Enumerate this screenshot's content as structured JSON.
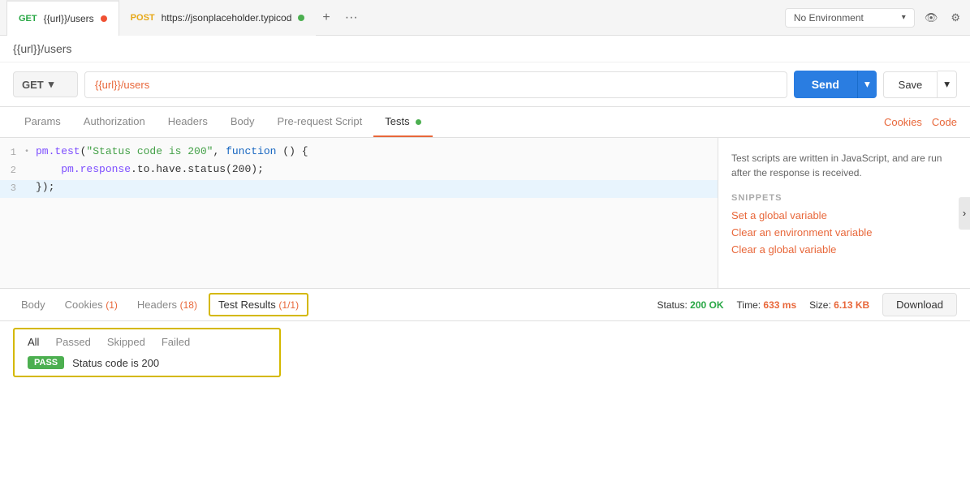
{
  "tabs": [
    {
      "id": "tab1",
      "method": "GET",
      "url": "{{url}}/users",
      "active": true,
      "dot_color": "orange"
    },
    {
      "id": "tab2",
      "method": "POST",
      "url": "https://jsonplaceholder.typicod",
      "active": false,
      "dot_color": "green"
    }
  ],
  "tab_actions": {
    "plus": "+",
    "more": "···"
  },
  "environment": {
    "label": "No Environment",
    "chevron": "▾"
  },
  "request": {
    "name": "{{url}}/users",
    "method": "GET",
    "url": "{{url}}/users",
    "send_label": "Send",
    "send_dropdown": "▾",
    "save_label": "Save",
    "save_dropdown": "▾"
  },
  "nav_tabs": [
    {
      "id": "params",
      "label": "Params",
      "active": false
    },
    {
      "id": "authorization",
      "label": "Authorization",
      "active": false
    },
    {
      "id": "headers",
      "label": "Headers",
      "active": false
    },
    {
      "id": "body",
      "label": "Body",
      "active": false
    },
    {
      "id": "pre-request",
      "label": "Pre-request Script",
      "active": false
    },
    {
      "id": "tests",
      "label": "Tests",
      "active": true,
      "dot": true
    }
  ],
  "nav_right": {
    "cookies": "Cookies",
    "code": "Code"
  },
  "code_editor": {
    "lines": [
      {
        "num": 1,
        "bullet": "•",
        "code": "pm.test(\"Status code is 200\", function () {",
        "highlight": false
      },
      {
        "num": 2,
        "bullet": "",
        "code": "    pm.response.to.have.status(200);",
        "highlight": false
      },
      {
        "num": 3,
        "bullet": "",
        "code": "});",
        "highlight": true
      }
    ]
  },
  "snippets": {
    "info": "Test scripts are written in JavaScript, and are run after the response is received.",
    "label": "SNIPPETS",
    "items": [
      "Set a global variable",
      "Clear an environment variable",
      "Clear a global variable"
    ]
  },
  "response": {
    "tabs": [
      {
        "id": "body",
        "label": "Body",
        "active": false
      },
      {
        "id": "cookies",
        "label": "Cookies",
        "badge": "(1)",
        "active": false
      },
      {
        "id": "headers",
        "label": "Headers",
        "badge": "(18)",
        "active": false
      },
      {
        "id": "test-results",
        "label": "Test Results",
        "badge": "(1/1)",
        "active": true
      }
    ],
    "status": "200 OK",
    "time": "633 ms",
    "size": "6.13 KB",
    "download": "Download"
  },
  "test_results": {
    "filter_tabs": [
      "All",
      "Passed",
      "Skipped",
      "Failed"
    ],
    "active_filter": "All",
    "rows": [
      {
        "status": "PASS",
        "name": "Status code is 200"
      }
    ]
  }
}
